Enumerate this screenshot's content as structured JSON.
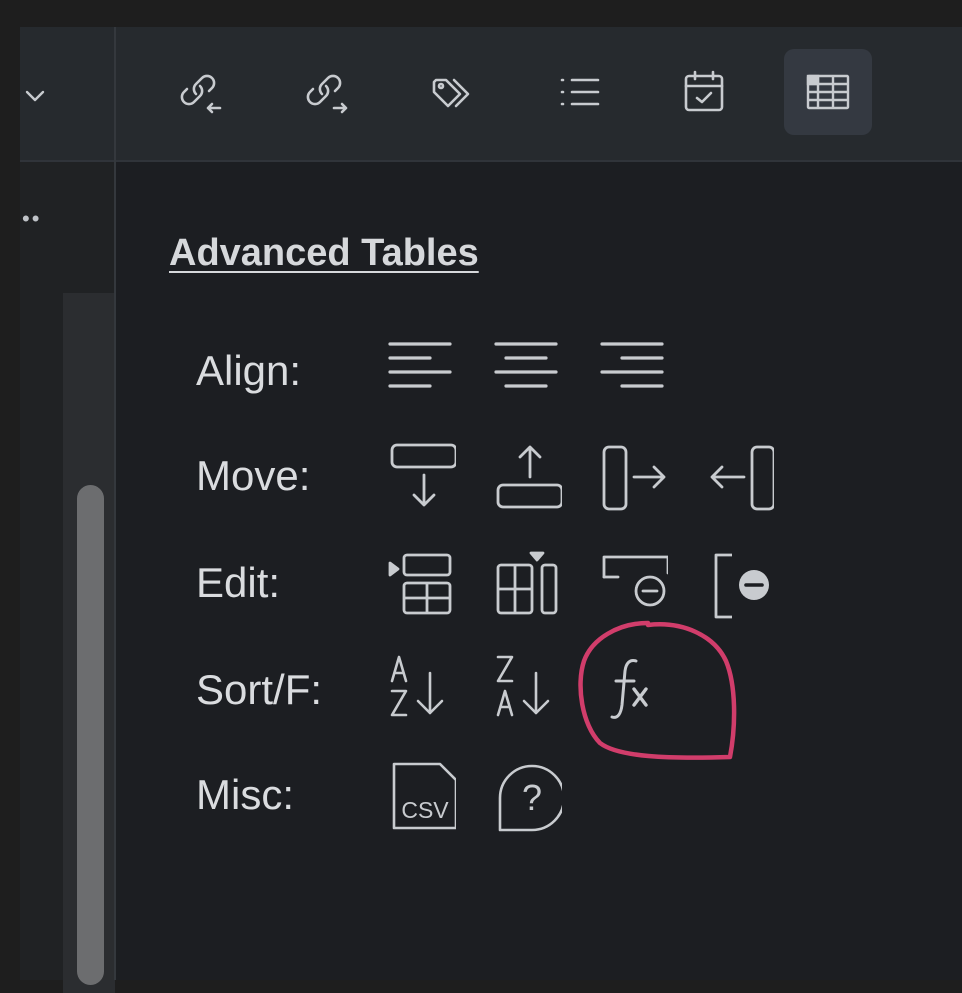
{
  "toolbar": {
    "buttons": [
      {
        "icon": "backlink-in-icon",
        "active": false
      },
      {
        "icon": "outgoing-link-icon",
        "active": false
      },
      {
        "icon": "tags-icon",
        "active": false
      },
      {
        "icon": "outline-list-icon",
        "active": false
      },
      {
        "icon": "calendar-check-icon",
        "active": false
      },
      {
        "icon": "table-icon",
        "active": true
      }
    ]
  },
  "left_pane": {
    "chevron_icon": "chevron-down-icon",
    "more_icon": "ellipsis-icon"
  },
  "panel": {
    "title": "Advanced Tables",
    "rows": [
      {
        "label": "Align:",
        "actions": [
          "align-left-icon",
          "align-center-icon",
          "align-right-icon"
        ]
      },
      {
        "label": "Move:",
        "actions": [
          "move-row-down-icon",
          "move-row-up-icon",
          "move-column-right-icon",
          "move-column-left-icon"
        ]
      },
      {
        "label": "Edit:",
        "actions": [
          "insert-row-icon",
          "insert-column-icon",
          "delete-row-icon",
          "delete-column-icon"
        ]
      },
      {
        "label": "Sort/F:",
        "actions": [
          "sort-az-icon",
          "sort-za-icon",
          "formula-icon"
        ]
      },
      {
        "label": "Misc:",
        "actions": [
          "export-csv-icon",
          "help-icon"
        ]
      }
    ],
    "csv_text": "CSV"
  },
  "colors": {
    "background": "#1c1e22",
    "toolbar": "#262a2e",
    "active_button": "#343941",
    "icon": "#c8cbcf",
    "text": "#dadcdf",
    "annotation": "#d13d6b"
  },
  "annotation": {
    "shape": "hand-drawn circle",
    "target": "formula-icon",
    "color": "#d13d6b"
  }
}
